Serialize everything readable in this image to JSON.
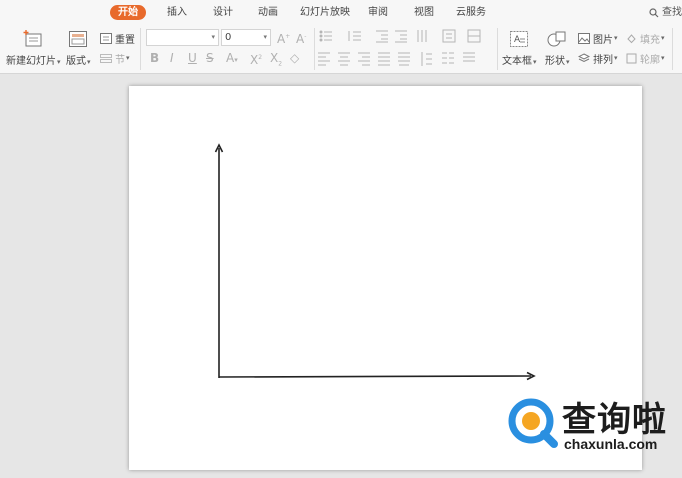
{
  "tabs": {
    "home": "开始",
    "insert": "插入",
    "design": "设计",
    "animation": "动画",
    "slideshow": "幻灯片放映",
    "review": "审阅",
    "view": "视图",
    "cloud": "云服务"
  },
  "search": {
    "label": "查找"
  },
  "ribbon": {
    "new_slide": "新建幻灯片",
    "layout": "版式",
    "reset": "重置",
    "section": "节",
    "font_size": "0",
    "textbox": "文本框",
    "shape": "形状",
    "picture": "图片",
    "arrange": "排列",
    "fill": "填充",
    "outline": "轮廓"
  },
  "colors": {
    "accent": "#e86a2c",
    "slide_bg": "#ffffff",
    "workspace_bg": "#e6e6e6"
  },
  "watermark": {
    "name": "查询啦",
    "url": "chaxunla.com"
  }
}
